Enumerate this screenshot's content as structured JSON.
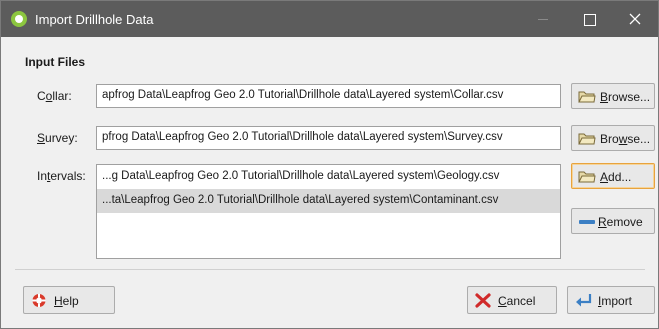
{
  "window": {
    "title": "Import Drillhole Data"
  },
  "section": {
    "title": "Input Files"
  },
  "collar": {
    "label_pre": "C",
    "label_u": "o",
    "label_post": "llar:",
    "value": "apfrog Data\\Leapfrog Geo 2.0 Tutorial\\Drillhole data\\Layered system\\Collar.csv",
    "browse_pre": "",
    "browse_u": "B",
    "browse_post": "rowse..."
  },
  "survey": {
    "label_pre": "",
    "label_u": "S",
    "label_post": "urvey:",
    "value": "pfrog Data\\Leapfrog Geo 2.0 Tutorial\\Drillhole data\\Layered system\\Survey.csv",
    "browse_pre": "Bro",
    "browse_u": "w",
    "browse_post": "se..."
  },
  "intervals": {
    "label_pre": "In",
    "label_u": "t",
    "label_post": "ervals:",
    "items": [
      "...g Data\\Leapfrog Geo 2.0 Tutorial\\Drillhole data\\Layered system\\Geology.csv",
      "...ta\\Leapfrog Geo 2.0 Tutorial\\Drillhole data\\Layered system\\Contaminant.csv"
    ],
    "add_pre": "",
    "add_u": "A",
    "add_post": "dd...",
    "remove_pre": "",
    "remove_u": "R",
    "remove_post": "emove"
  },
  "footer": {
    "help_pre": "",
    "help_u": "H",
    "help_post": "elp",
    "cancel_pre": "",
    "cancel_u": "C",
    "cancel_post": "ancel",
    "import_pre": "",
    "import_u": "I",
    "import_post": "mport"
  },
  "colors": {
    "titlebar": "#5c5c5c",
    "app_icon": "#8cc63f",
    "focus_border": "#e8a33d",
    "selection": "#d9d9d9"
  }
}
